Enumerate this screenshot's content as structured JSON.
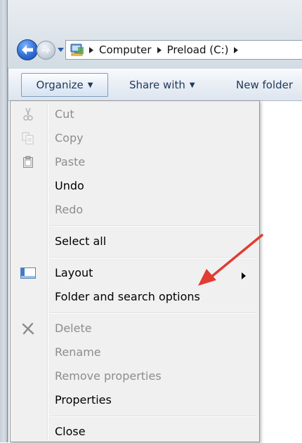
{
  "address_bar": {
    "crumbs": [
      "Computer",
      "Preload (C:)"
    ]
  },
  "command_bar": {
    "organize_label": "Organize",
    "share_label": "Share with",
    "new_folder_label": "New folder"
  },
  "menu": {
    "items": [
      {
        "label": "Cut",
        "enabled": false,
        "icon": "scissors-icon"
      },
      {
        "label": "Copy",
        "enabled": false,
        "icon": "copy-icon"
      },
      {
        "label": "Paste",
        "enabled": false,
        "icon": "clipboard-icon"
      },
      {
        "label": "Undo",
        "enabled": true
      },
      {
        "label": "Redo",
        "enabled": false
      },
      {
        "label": "Select all",
        "enabled": true
      },
      {
        "label": "Layout",
        "enabled": true,
        "icon": "layout-icon",
        "submenu": true
      },
      {
        "label": "Folder and search options",
        "enabled": true
      },
      {
        "label": "Delete",
        "enabled": false,
        "icon": "delete-x-icon"
      },
      {
        "label": "Rename",
        "enabled": false
      },
      {
        "label": "Remove properties",
        "enabled": false
      },
      {
        "label": "Properties",
        "enabled": true
      },
      {
        "label": "Close",
        "enabled": true
      }
    ]
  },
  "colors": {
    "annotation_arrow": "#e03c31",
    "menu_background": "#f0f0f0",
    "disabled_text": "#8d8d8d",
    "command_text": "#1e395b"
  }
}
